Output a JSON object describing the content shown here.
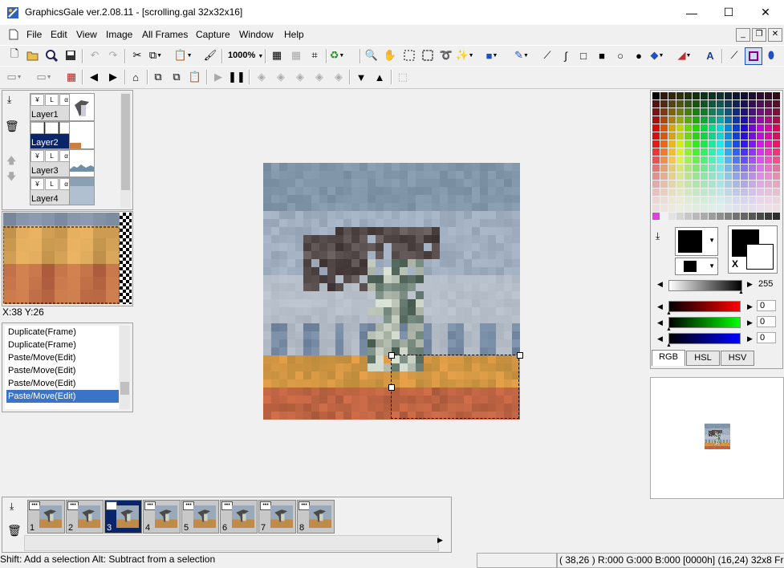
{
  "window": {
    "title": "GraphicsGale ver.2.08.11 - [scrolling.gal 32x32x16]",
    "minimize": "—",
    "maximize": "☐",
    "close": "✕"
  },
  "menu": [
    "File",
    "Edit",
    "View",
    "Image",
    "All Frames",
    "Capture",
    "Window",
    "Help"
  ],
  "toolbar": {
    "zoom": "1000%"
  },
  "layers": [
    {
      "name": "Layer1",
      "selected": false
    },
    {
      "name": "Layer2",
      "selected": true
    },
    {
      "name": "Layer3",
      "selected": false
    },
    {
      "name": "Layer4",
      "selected": false
    }
  ],
  "layer_button_labels": [
    "¥",
    "L",
    "α",
    "•••"
  ],
  "coords": "X:38 Y:26",
  "history": [
    {
      "label": "Duplicate(Frame)",
      "selected": false
    },
    {
      "label": "Duplicate(Frame)",
      "selected": false
    },
    {
      "label": "Paste/Move(Edit)",
      "selected": false
    },
    {
      "label": "Paste/Move(Edit)",
      "selected": false
    },
    {
      "label": "Paste/Move(Edit)",
      "selected": false
    },
    {
      "label": "Paste/Move(Edit)",
      "selected": true
    }
  ],
  "color_tabs": [
    "RGB",
    "HSL",
    "HSV"
  ],
  "sliders": {
    "alpha": {
      "value": "255",
      "fraction": 1.0
    },
    "red": {
      "value": "0",
      "fraction": 0
    },
    "green": {
      "value": "0",
      "fraction": 0
    },
    "blue": {
      "value": "0",
      "fraction": 0
    }
  },
  "swap_label": "X",
  "frames": [
    "1",
    "2",
    "3",
    "4",
    "5",
    "6",
    "7",
    "8"
  ],
  "selected_frame": "3",
  "status": {
    "hint": "Shift: Add a selection  Alt: Subtract from a selection",
    "info": "( 38,26 ) R:000 G:000 B:000  [0000h]  (16,24) 32x8  Fr"
  },
  "colors": {
    "selection_blue": "#0a246a",
    "history_highlight": "#3b73c6",
    "sky": "#98a8b8",
    "ground": "#c8a050"
  }
}
